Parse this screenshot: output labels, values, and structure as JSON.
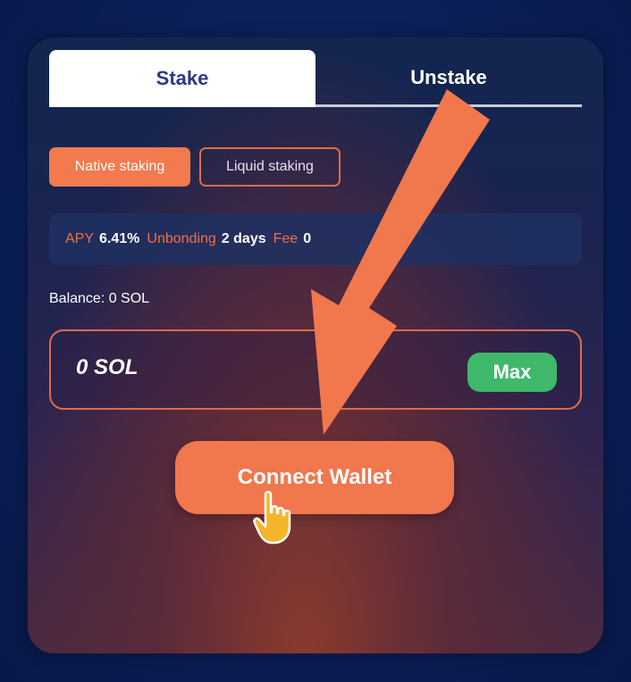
{
  "tabs": [
    {
      "label": "Stake",
      "active": true
    },
    {
      "label": "Unstake",
      "active": false
    }
  ],
  "staking_types": [
    {
      "label": "Native staking",
      "selected": true
    },
    {
      "label": "Liquid staking",
      "selected": false
    }
  ],
  "info": {
    "apy_label": "APY",
    "apy_value": "6.41%",
    "unbonding_label": "Unbonding",
    "unbonding_value": "2 days",
    "fee_label": "Fee",
    "fee_value": "0"
  },
  "balance": "Balance: 0 SOL",
  "amount_field": {
    "value": "0 SOL",
    "max_label": "Max"
  },
  "connect_label": "Connect Wallet",
  "icons": {
    "cursor": "hand-pointer-icon",
    "arrow": "arrow-annotation-icon"
  },
  "colors": {
    "accent": "#f27a4e",
    "max_green": "#3fb86a",
    "tab_active_text": "#2a3a86",
    "background": "#0b1f57"
  }
}
